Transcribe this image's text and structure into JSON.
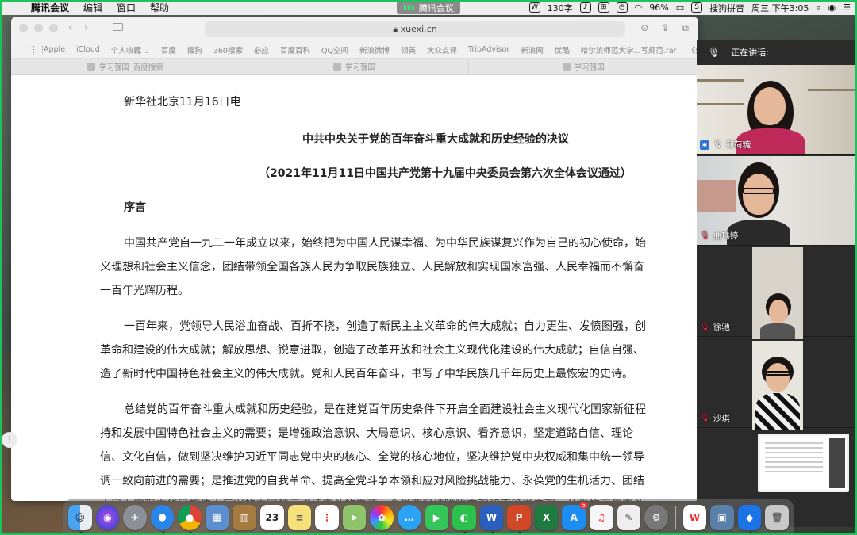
{
  "menubar": {
    "app_name": "腾讯会议",
    "items": [
      "编辑",
      "窗口",
      "帮助"
    ],
    "meeting_pill": "腾讯会议",
    "word_count": "130字",
    "battery": "96%",
    "input_method": "搜狗拼音",
    "clock": "周三 下午3:05"
  },
  "browser": {
    "url": "xuexi.cn",
    "bookmarks": [
      "Apple",
      "iCloud",
      "个人收藏 ⌄",
      "百度",
      "搜狗",
      "360搜索",
      "必应",
      "百度百科",
      "QQ空间",
      "新浪微博",
      "领英",
      "大众点评",
      "TripAdvisor",
      "新浪网",
      "优酷",
      "哈尔滨师范大学...写规范.rar",
      "《外国文"
    ],
    "tabs": [
      "学习强国_百度搜索",
      "学习强国",
      "学习强国"
    ]
  },
  "article": {
    "dateline": "新华社北京11月16日电",
    "title": "中共中央关于党的百年奋斗重大成就和历史经验的决议",
    "subtitle": "（2021年11月11日中国共产党第十九届中央委员会第六次全体会议通过）",
    "section": "序言",
    "paragraphs": [
      [
        "中国共产党自一九二一年成立以来，始终把为中国人民谋幸福、为中华民族谋复兴作为自己的初心使命，始",
        "义理想和社会主义信念，团结带领全国各族人民为争取民族独立、人民解放和实现国家富强、人民幸福而不懈奋",
        "一百年光辉历程。"
      ],
      [
        "一百年来，党领导人民浴血奋战、百折不挠，创造了新民主主义革命的伟大成就；自力更生、发愤图强，创",
        "革命和建设的伟大成就；解放思想、锐意进取，创造了改革开放和社会主义现代化建设的伟大成就；自信自强、",
        "造了新时代中国特色社会主义的伟大成就。党和人民百年奋斗，书写了中华民族几千年历史上最恢宏的史诗。"
      ],
      [
        "总结党的百年奋斗重大成就和历史经验，是在建党百年历史条件下开启全面建设社会主义现代化国家新征程",
        "持和发展中国特色社会主义的需要；是增强政治意识、大局意识、核心意识、看齐意识，坚定道路自信、理论",
        "信、文化自信，做到坚决维护习近平同志党中央的核心、全党的核心地位，坚决维护党中央权威和集中统一领导",
        "调一致向前进的需要；是推进党的自我革命、提高全党斗争本领和应对风险挑战能力、永葆党的生机活力、团结",
        "人民为实现中华民族伟大复兴的中国梦而继续奋斗的需要。全党要坚持唯物史观和正确党史观，从党的百年奋斗"
      ]
    ]
  },
  "meeting": {
    "speaking_label": "正在讲话:",
    "participants": [
      {
        "name": "薄荷糖"
      },
      {
        "name": "曲玮婷"
      },
      {
        "name": "徐驰"
      },
      {
        "name": "沙琪"
      }
    ]
  },
  "dock": {
    "calendar_day": "23",
    "appstore_badge": "5"
  }
}
